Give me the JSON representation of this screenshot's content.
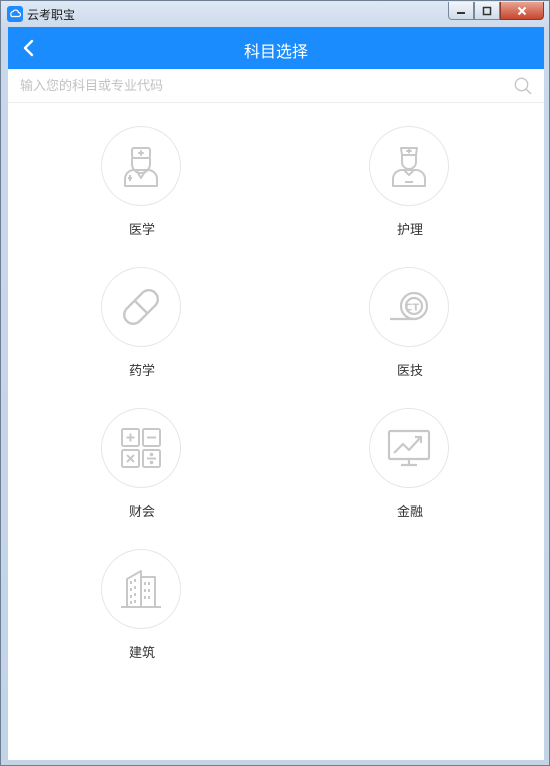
{
  "window": {
    "title": "云考职宝"
  },
  "header": {
    "title": "科目选择"
  },
  "search": {
    "placeholder": "输入您的科目或专业代码",
    "value": ""
  },
  "subjects": [
    {
      "label": "医学",
      "icon": "doctor-icon"
    },
    {
      "label": "护理",
      "icon": "nurse-icon"
    },
    {
      "label": "药学",
      "icon": "pill-icon"
    },
    {
      "label": "医技",
      "icon": "ct-scan-icon"
    },
    {
      "label": "财会",
      "icon": "calculator-icon"
    },
    {
      "label": "金融",
      "icon": "stock-chart-icon"
    },
    {
      "label": "建筑",
      "icon": "building-icon"
    }
  ],
  "colors": {
    "accent": "#1a8cfe",
    "icon_gray": "#c8c8c8"
  }
}
